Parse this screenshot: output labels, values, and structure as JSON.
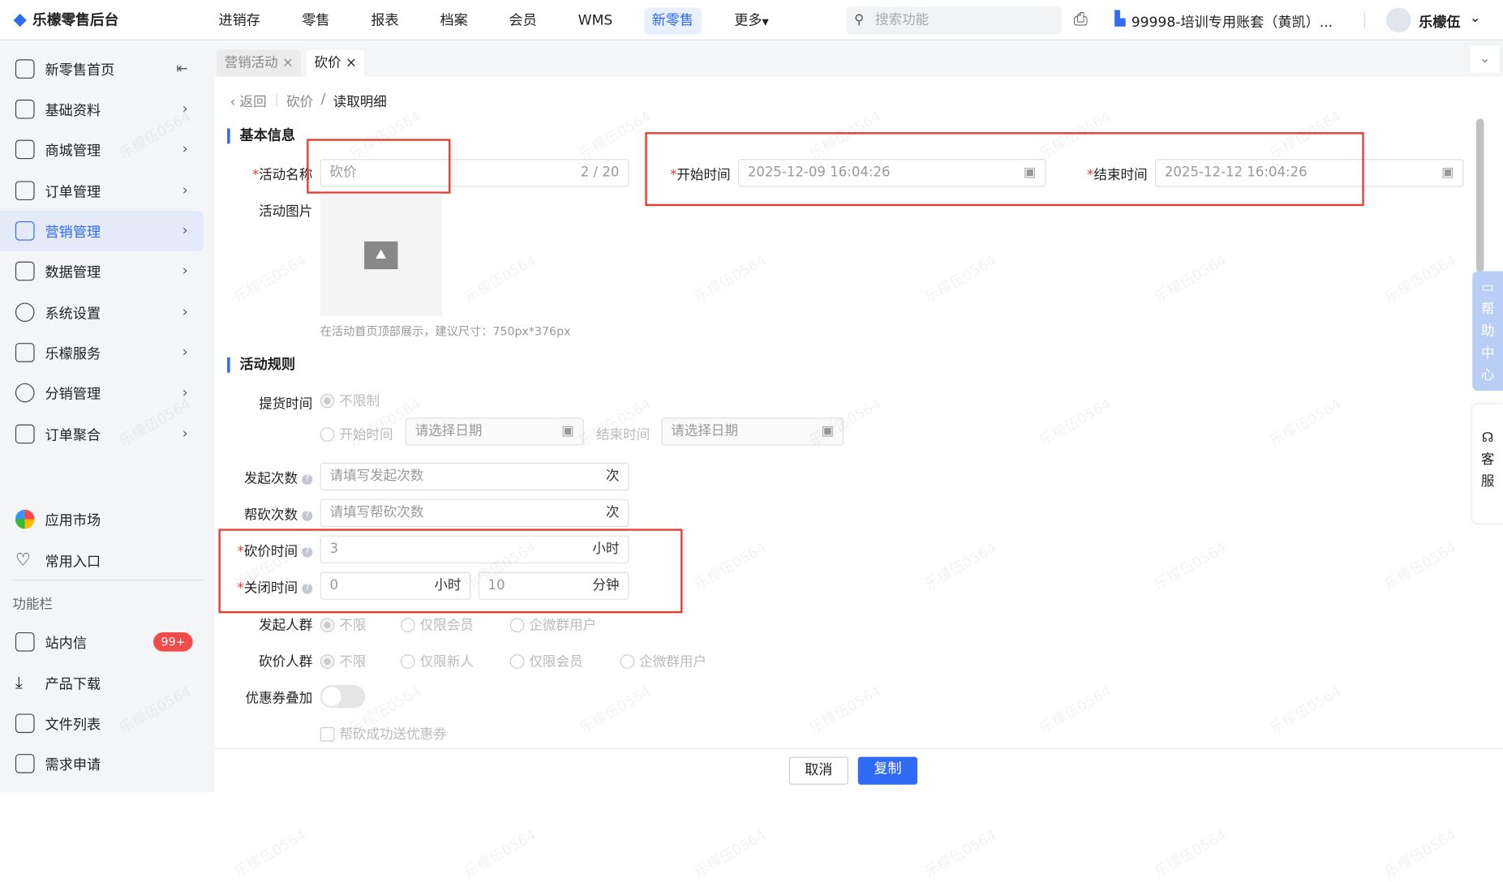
{
  "app": {
    "title": "乐檬零售后台"
  },
  "topnav": [
    "进销存",
    "零售",
    "报表",
    "档案",
    "会员",
    "WMS",
    "新零售",
    "更多"
  ],
  "search": {
    "placeholder": "搜索功能"
  },
  "account": "99998-培训专用账套（黄凯）...",
  "user": "乐檬伍",
  "sidebar": {
    "items": [
      "新零售首页",
      "基础资料",
      "商城管理",
      "订单管理",
      "营销管理",
      "数据管理",
      "系统设置",
      "乐檬服务",
      "分销管理",
      "订单聚合"
    ],
    "extra": [
      "应用市场",
      "常用入口"
    ],
    "section": "功能栏",
    "func": [
      "站内信",
      "产品下载",
      "文件列表",
      "需求申请"
    ],
    "badge": "99+"
  },
  "tabs": [
    "营销活动",
    "砍价"
  ],
  "breadcrumb": {
    "back": "返回",
    "parent": "砍价",
    "current": "读取明细"
  },
  "basic": {
    "title": "基本信息",
    "name_label": "活动名称",
    "name_value": "砍价",
    "name_count": "2 / 20",
    "start_label": "开始时间",
    "start_value": "2025-12-09 16:04:26",
    "end_label": "结束时间",
    "end_value": "2025-12-12 16:04:26",
    "image_label": "活动图片",
    "image_hint": "在活动首页顶部展示，建议尺寸：750px*376px"
  },
  "rules": {
    "title": "活动规则",
    "pickup_label": "提货时间",
    "pickup_unlimited": "不限制",
    "pickup_start": "开始时间",
    "pickup_end": "结束时间",
    "date_placeholder": "请选择日期",
    "launch_label": "发起次数",
    "launch_placeholder": "请填写发起次数",
    "unit_times": "次",
    "help_label": "帮砍次数",
    "help_placeholder": "请填写帮砍次数",
    "cut_label": "砍价时间",
    "cut_value": "3",
    "unit_hour": "小时",
    "close_label": "关闭时间",
    "close_hours": "0",
    "close_minutes": "10",
    "unit_minute": "分钟",
    "launcher_label": "发起人群",
    "launcher_opts": [
      "不限",
      "仅限会员",
      "企微群用户"
    ],
    "cutter_label": "砍价人群",
    "cutter_opts": [
      "不限",
      "仅限新人",
      "仅限会员",
      "企微群用户"
    ],
    "coupon_label": "优惠券叠加",
    "send_coupon": "帮砍成功送优惠券"
  },
  "float": {
    "help": "帮助中心",
    "service": "客服"
  },
  "footer": {
    "cancel": "取消",
    "copy": "复制"
  },
  "watermark": "乐檬伍0564"
}
